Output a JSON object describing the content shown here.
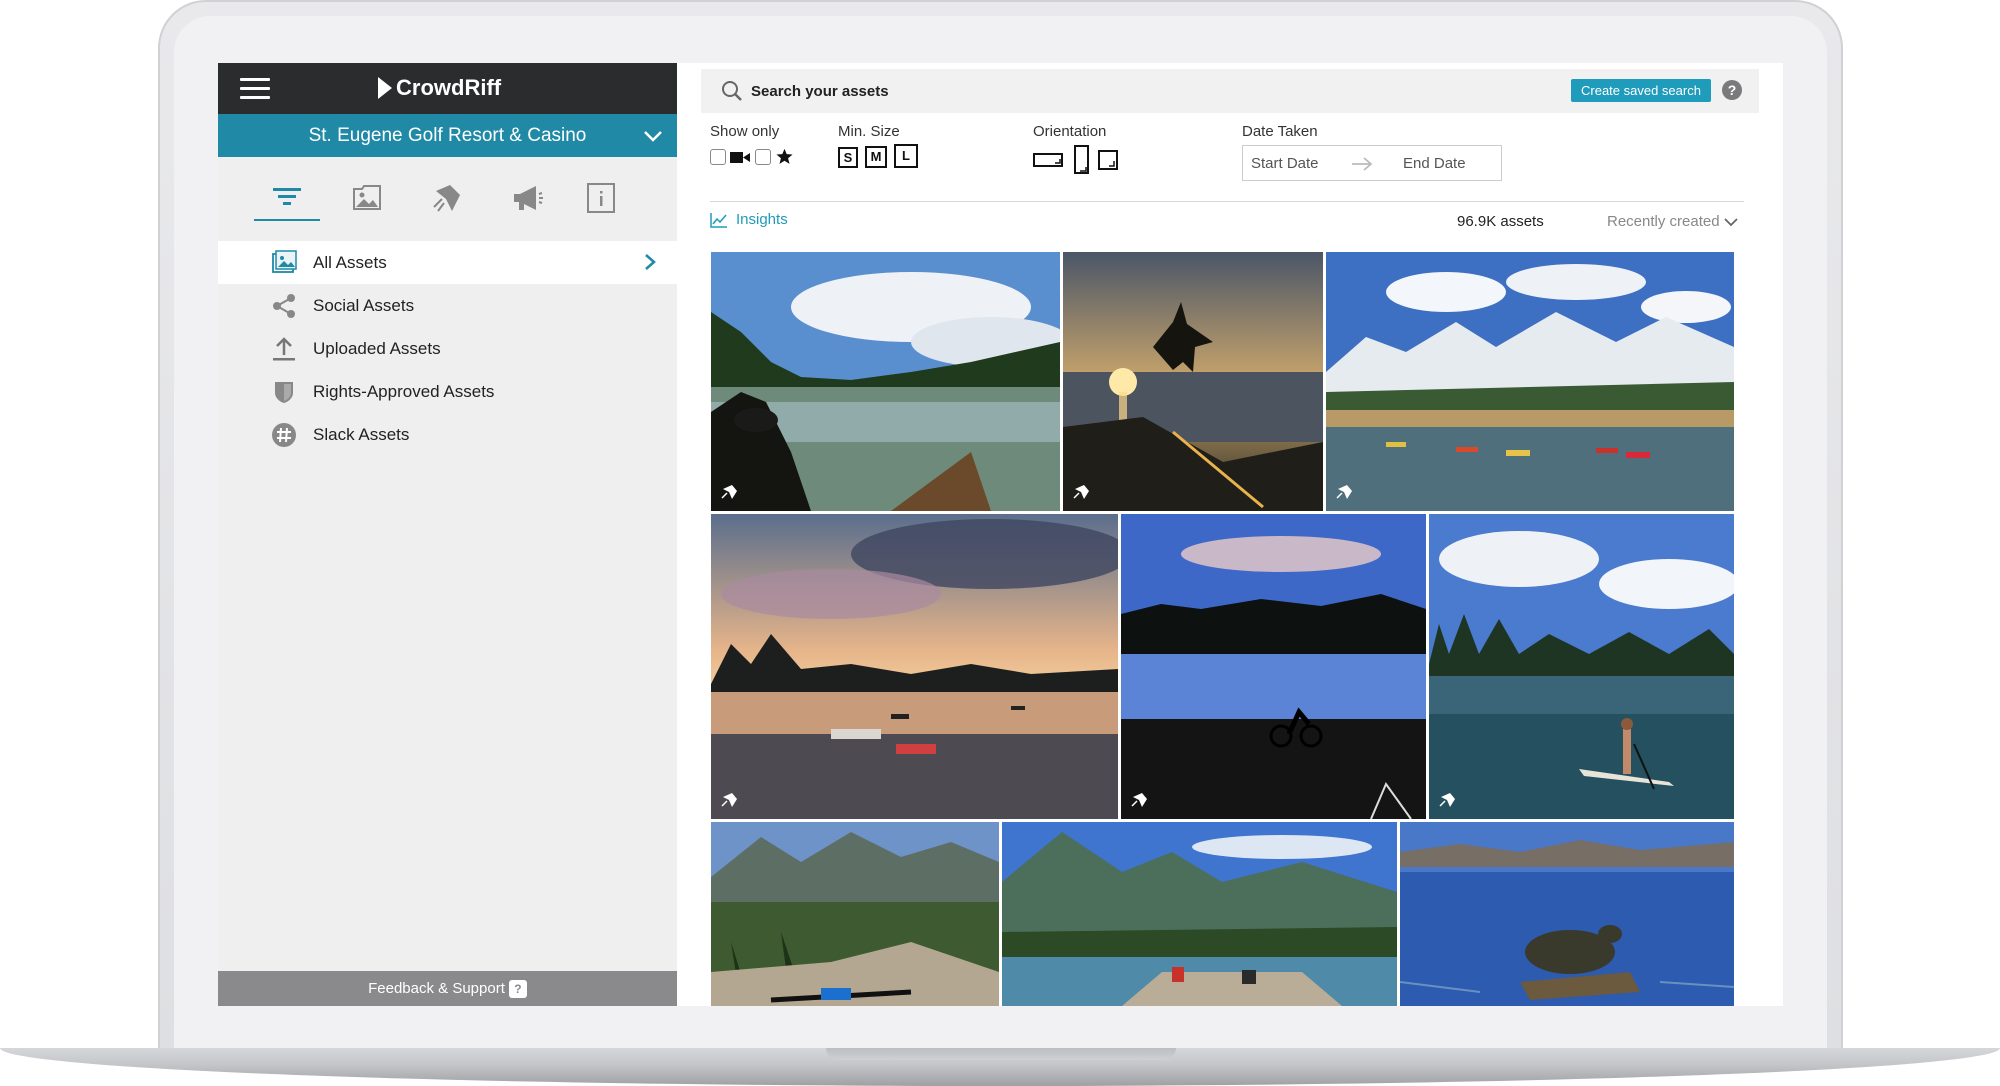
{
  "app": {
    "brand": "CrowdRiff",
    "account": "St. Eugene Golf Resort & Casino"
  },
  "sidebar": {
    "nav_icons": [
      {
        "name": "filter-icon",
        "active": true
      },
      {
        "name": "gallery-icon",
        "active": false
      },
      {
        "name": "crowdriff-icon",
        "active": false
      },
      {
        "name": "megaphone-icon",
        "active": false
      },
      {
        "name": "info-icon",
        "active": false
      }
    ],
    "items": [
      {
        "label": "All Assets",
        "icon": "image-icon",
        "active": true
      },
      {
        "label": "Social Assets",
        "icon": "share-icon",
        "active": false
      },
      {
        "label": "Uploaded Assets",
        "icon": "upload-icon",
        "active": false
      },
      {
        "label": "Rights-Approved Assets",
        "icon": "shield-icon",
        "active": false
      },
      {
        "label": "Slack Assets",
        "icon": "slack-icon",
        "active": false
      }
    ],
    "feedback_label": "Feedback & Support",
    "feedback_badge": "?"
  },
  "search": {
    "placeholder": "Search your assets",
    "saved_button": "Create saved search",
    "help": "?"
  },
  "filters": {
    "show_only_label": "Show only",
    "min_size_label": "Min. Size",
    "sizes": [
      "S",
      "M",
      "L"
    ],
    "orientation_label": "Orientation",
    "date_label": "Date Taken",
    "start_date_placeholder": "Start Date",
    "end_date_placeholder": "End Date"
  },
  "results": {
    "insights_label": "Insights",
    "count": "96.9K assets",
    "sort": "Recently created"
  },
  "colors": {
    "accent": "#1f89a6",
    "topbar": "#2b2c2e",
    "sidebar_bg": "#efeff0"
  },
  "photos": [
    {
      "subject": "person in canoe on lake"
    },
    {
      "subject": "person jumping at sunset"
    },
    {
      "subject": "kayakers below snowy mountains"
    },
    {
      "subject": "kayakers on lake at sunset"
    },
    {
      "subject": "cyclist silhouette by lake"
    },
    {
      "subject": "paddleboarder on lake"
    },
    {
      "subject": "mountain bike on rocky overlook"
    },
    {
      "subject": "campers by river"
    },
    {
      "subject": "turtle on log in water"
    }
  ]
}
